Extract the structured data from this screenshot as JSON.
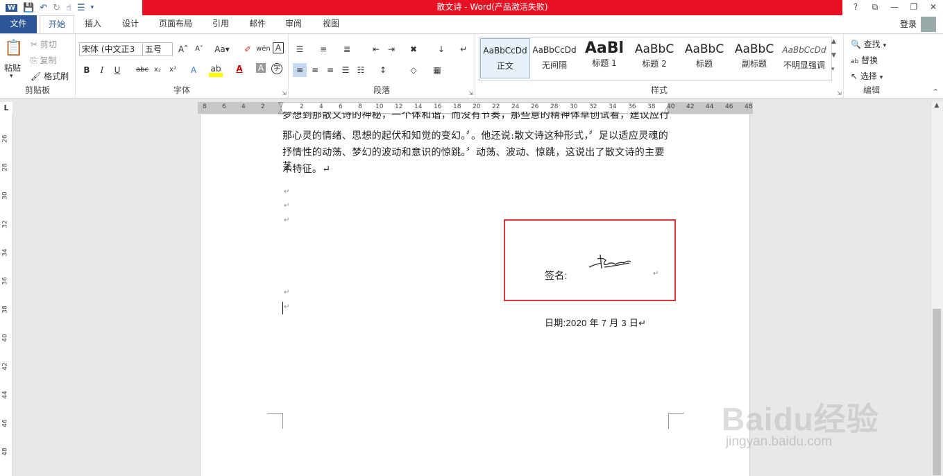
{
  "title": "散文诗 - Word(产品激活失败)",
  "window_controls": [
    "?",
    "⧉",
    "—",
    "❐",
    "✕"
  ],
  "tabs": {
    "file": "文件",
    "items": [
      "开始",
      "插入",
      "设计",
      "页面布局",
      "引用",
      "邮件",
      "审阅",
      "视图"
    ],
    "active": "开始"
  },
  "account": {
    "login": "登录"
  },
  "ribbon": {
    "clipboard": {
      "paste": "粘贴",
      "cut": "剪切",
      "copy": "复制",
      "format_painter": "格式刷",
      "label": "剪贴板"
    },
    "font": {
      "family": "宋体 (中文正文)",
      "family_shown": "宋体 (中文正3",
      "size": "五号",
      "label": "字体"
    },
    "paragraph": {
      "label": "段落"
    },
    "styles": {
      "items": [
        {
          "sample": "AaBbCcDd",
          "name": "正文"
        },
        {
          "sample": "AaBbCcDd",
          "name": "无间隔"
        },
        {
          "sample": "AaBl",
          "name": "标题 1"
        },
        {
          "sample": "AaBbC",
          "name": "标题 2"
        },
        {
          "sample": "AaBbC",
          "name": "标题"
        },
        {
          "sample": "AaBbC",
          "name": "副标题"
        },
        {
          "sample": "AaBbCcDd",
          "name": "不明显强调"
        }
      ],
      "label": "样式"
    },
    "editing": {
      "find": "查找",
      "replace": "替换",
      "select": "选择",
      "label": "编辑"
    }
  },
  "ruler": {
    "top_left": [
      "8",
      "6",
      "4",
      "2"
    ],
    "top_right": [
      "2",
      "4",
      "6",
      "8",
      "10",
      "12",
      "14",
      "16",
      "18",
      "20",
      "22",
      "24",
      "26",
      "28",
      "30",
      "32",
      "34",
      "36",
      "38",
      "40",
      "42",
      "44",
      "46",
      "48"
    ],
    "left": [
      "26",
      "28",
      "30",
      "32",
      "34",
      "36",
      "38",
      "40",
      "42",
      "44",
      "46",
      "48"
    ],
    "corner": "L"
  },
  "document": {
    "lines": [
      "梦想到那散文诗的神秘，一个体和谐，而没有节奏，那些意的精神体草创试看，建议应行",
      "那心灵的情绪、思想的起伏和知觉的变幻。〞。他还说:散文诗这种形式，〞足以适应灵魂的",
      "抒情性的动荡、梦幻的波动和意识的惊跳。〞动荡、波动、惊跳，这说出了散文诗的主要艺",
      "术特征。↵"
    ],
    "signature_label": "签名:",
    "date_line": "日期:2020 年 7 月 3 日↵"
  },
  "watermark": {
    "text": "Baidu经验",
    "url": "jingyan.baidu.com"
  },
  "colors": {
    "title_bar": "#e81123",
    "file_tab": "#2b579a",
    "highlight_box": "#d9363e"
  }
}
